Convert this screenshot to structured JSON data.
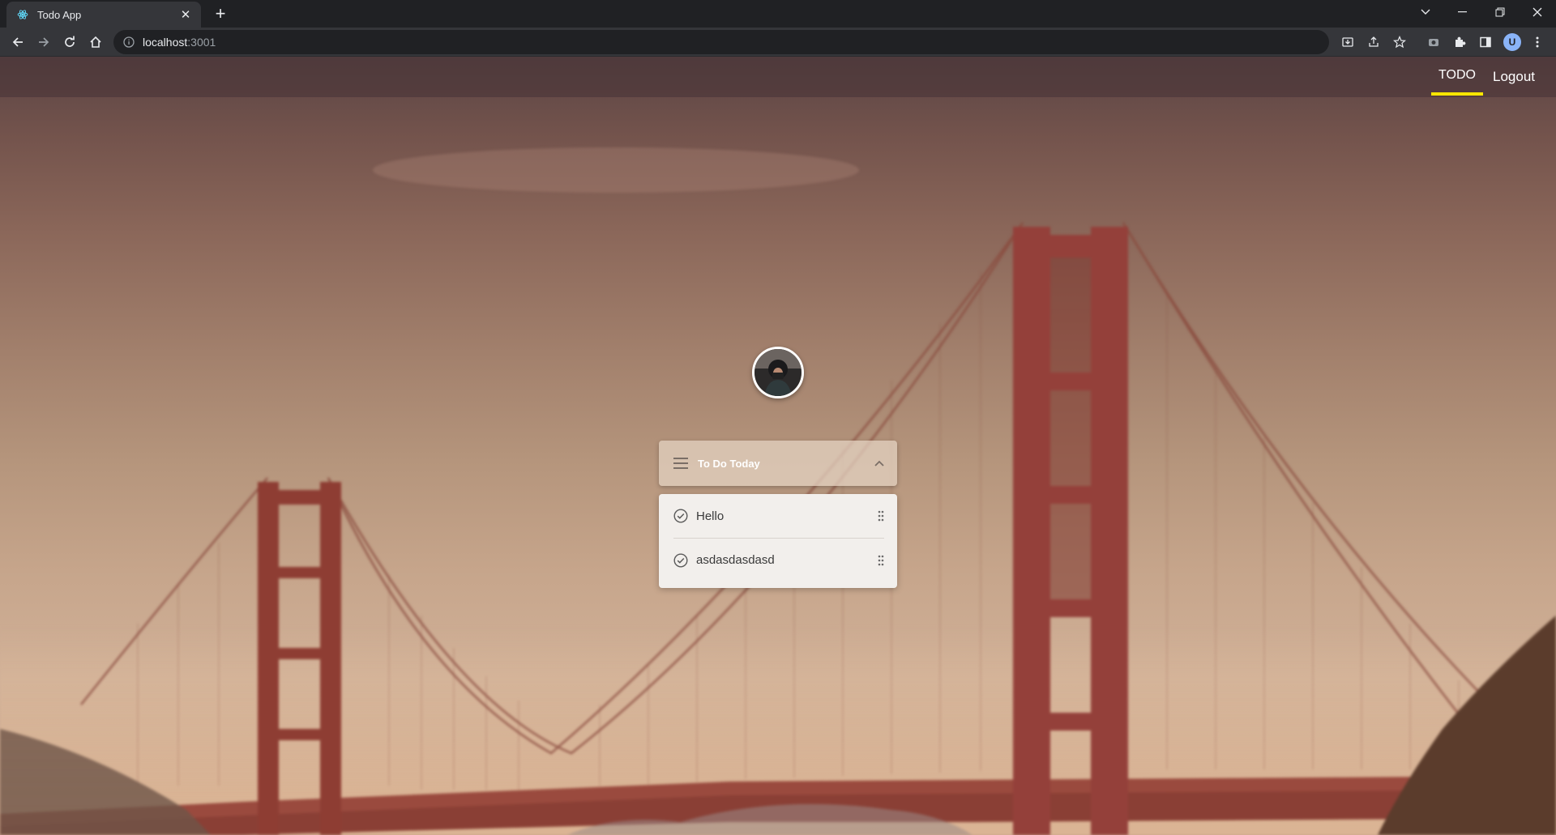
{
  "browser": {
    "tab_title": "Todo App",
    "tab_favicon": "react-icon",
    "new_tab_label": "+",
    "url_host": "localhost",
    "url_port": ":3001",
    "profile_initial": "U"
  },
  "navbar": {
    "todo_label": "TODO",
    "logout_label": "Logout",
    "active_underline_color": "#f7e600"
  },
  "todo_list": {
    "title": "To Do Today",
    "items": [
      {
        "text": "Hello"
      },
      {
        "text": "asdasdasdasd"
      }
    ]
  }
}
